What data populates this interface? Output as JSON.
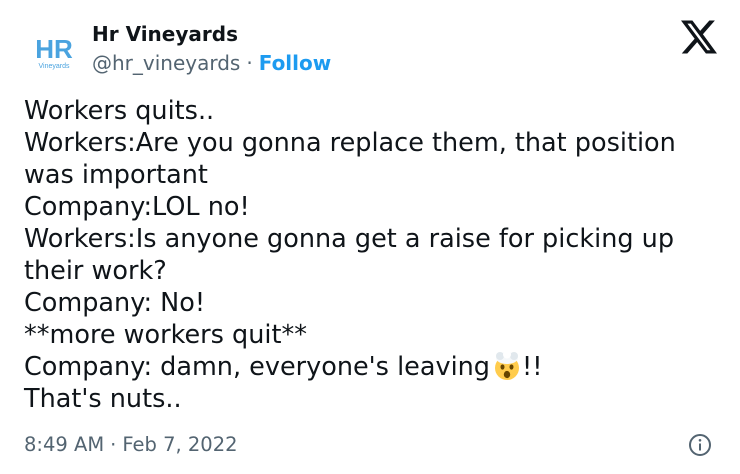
{
  "user": {
    "name": "Hr Vineyards",
    "handle": "@hr_vineyards",
    "separator": "·",
    "follow_label": "Follow",
    "avatar_text": "HR",
    "avatar_subtext": "Vineyards"
  },
  "tweet": {
    "lines": [
      "Workers quits..",
      "Workers:Are you gonna replace them, that position",
      "was important",
      "Company:LOL no!",
      "Workers:Is anyone gonna get a raise for picking up",
      "their work?",
      "Company: No!",
      "**more workers quit**",
      "Company: damn, everyone's leaving",
      "That's nuts.."
    ],
    "line9_suffix": "!!",
    "emoji": "exploding-head-emoji"
  },
  "footer": {
    "time": "8:49 AM",
    "separator": "·",
    "date": "Feb 7, 2022"
  },
  "icons": {
    "brand": "x-logo-icon",
    "info": "info-icon"
  },
  "colors": {
    "accent": "#1d9bf0",
    "secondary_text": "#536471",
    "primary_text": "#0f1419",
    "avatar_blue": "#4aa3df"
  }
}
